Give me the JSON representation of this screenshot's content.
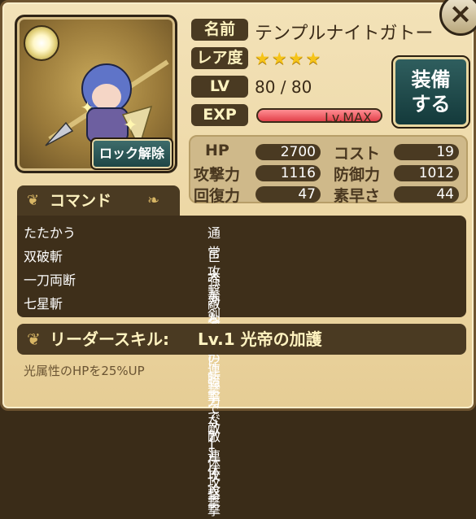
{
  "close_label": "×",
  "portrait": {
    "lock_label": "ロック解除",
    "element_icon": "light-orb-icon"
  },
  "info": {
    "name_label": "名前",
    "name": "テンプルナイトガトー",
    "rarity_label": "レア度",
    "rarity_stars": "★★★★",
    "lv_label": "LV",
    "lv": "80 / 80",
    "exp_label": "EXP",
    "exp_text": "Lv.MAX",
    "exp_fill": 1.0
  },
  "equip_label_1": "装備",
  "equip_label_2": "する",
  "stats": {
    "hp_label": "HP",
    "hp": "2700",
    "cost_label": "コスト",
    "cost": "19",
    "atk_label": "攻撃力",
    "atk": "1116",
    "def_label": "防御力",
    "def": "1012",
    "heal_label": "回復力",
    "heal": "47",
    "spd_label": "素早さ",
    "spd": "44"
  },
  "commands_title": "コマンド",
  "commands": [
    {
      "name": "たたかう",
      "desc": "通常攻撃"
    },
    {
      "name": "双破斬",
      "desc": "巨大な剣の2連撃で敵1体攻撃"
    },
    {
      "name": "一刀両断",
      "desc": "強力な縦の斬撃で敵1体攻撃"
    },
    {
      "name": "七星斬",
      "desc": "敵全体に強力な7連攻撃"
    }
  ],
  "leader": {
    "title": "リーダースキル:",
    "name": "Lv.1 光帝の加護",
    "desc": "光属性のHPを25%UP"
  }
}
